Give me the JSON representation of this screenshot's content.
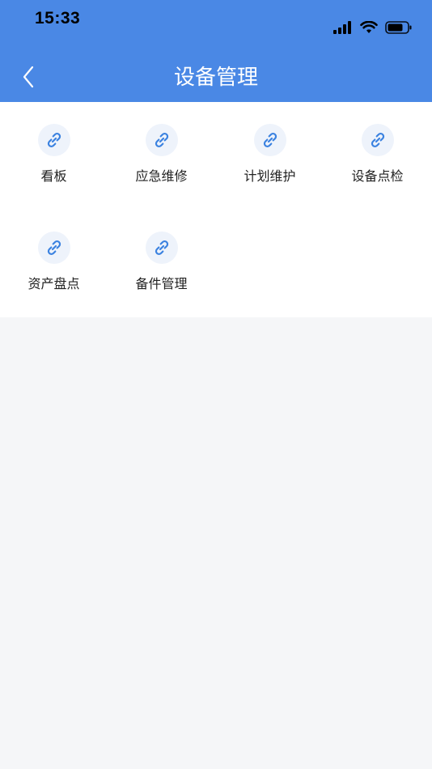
{
  "status_bar": {
    "time": "15:33",
    "icons": [
      "signal-icon",
      "wifi-icon",
      "battery-icon"
    ]
  },
  "nav": {
    "back_icon": "chevron-left-icon",
    "title": "设备管理"
  },
  "menu": {
    "items": [
      {
        "label": "看板",
        "icon": "link-icon"
      },
      {
        "label": "应急维修",
        "icon": "link-icon"
      },
      {
        "label": "计划维护",
        "icon": "link-icon"
      },
      {
        "label": "设备点检",
        "icon": "link-icon"
      },
      {
        "label": "资产盘点",
        "icon": "link-icon"
      },
      {
        "label": "备件管理",
        "icon": "link-icon"
      }
    ]
  },
  "colors": {
    "header_bg": "#4a88e5",
    "icon_blue": "#3b82e0",
    "icon_circle_bg": "#eef3fb",
    "page_bg": "#f5f6f8"
  }
}
